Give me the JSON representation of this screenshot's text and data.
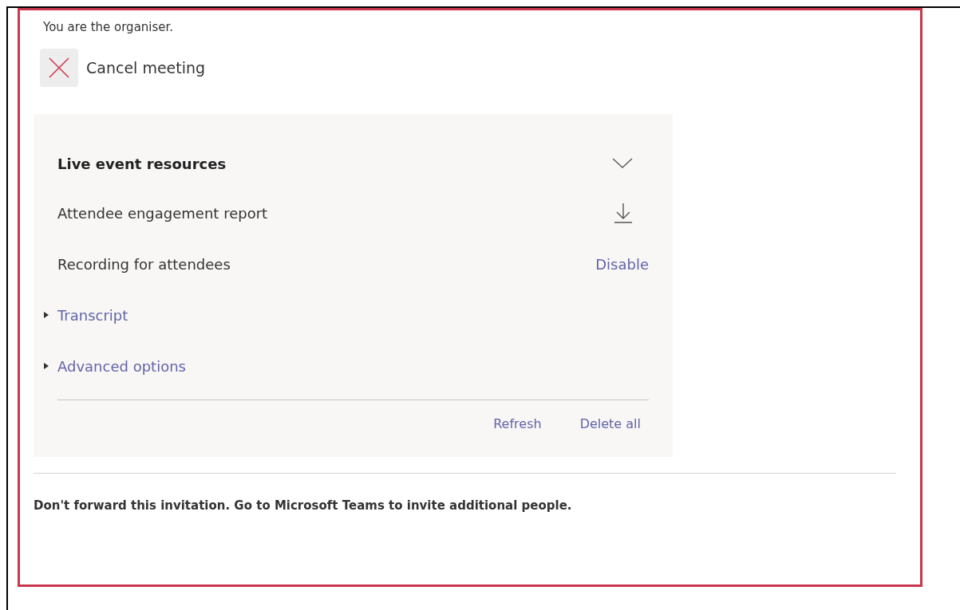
{
  "organiser_note": "You are the organiser.",
  "cancel_button": {
    "label": "Cancel meeting"
  },
  "resources_panel": {
    "rows": [
      {
        "kind": "header",
        "label": "Live event resources",
        "expanded": true
      },
      {
        "kind": "download",
        "label": "Attendee engagement report"
      },
      {
        "kind": "action",
        "label": "Recording for attendees",
        "action": "Disable"
      },
      {
        "kind": "expander",
        "label": "Transcript",
        "expanded": false
      },
      {
        "kind": "expander",
        "label": "Advanced options",
        "expanded": false
      }
    ],
    "footer_links": [
      "Refresh",
      "Delete all"
    ]
  },
  "footer_note": "Don't forward this invitation. Go to Microsoft Teams to invite additional people."
}
